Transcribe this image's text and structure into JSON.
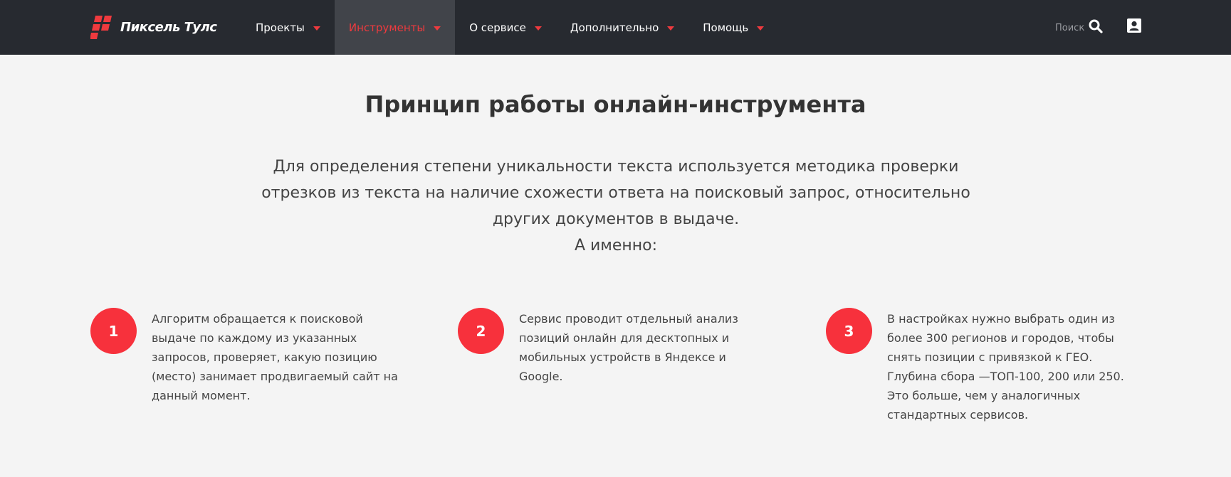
{
  "header": {
    "logo_text": "Пиксель Тулс",
    "nav": [
      {
        "label": "Проекты",
        "active": false
      },
      {
        "label": "Инструменты",
        "active": true
      },
      {
        "label": "О сервисе",
        "active": false
      },
      {
        "label": "Дополнительно",
        "active": false
      },
      {
        "label": "Помощь",
        "active": false
      }
    ],
    "search_label": "Поиск",
    "icons": {
      "logo": "pixel-tools-logo-icon",
      "caret": "caret-down-icon",
      "search": "search-icon",
      "user": "user-account-icon"
    }
  },
  "main": {
    "title": "Принцип работы онлайн-инструмента",
    "intro": "Для определения степени уникальности текста используется методика проверки отрезков из текста на наличие схожести ответа на поисковый запрос, относительно других документов в выдаче.",
    "intro_tail": "А именно:",
    "features": [
      {
        "number": "1",
        "text": "Алгоритм обращается к поисковой выдаче по каждому из указанных запросов, проверяет, какую позицию (место) занимает продвигаемый сайт на данный момент."
      },
      {
        "number": "2",
        "text": "Сервис проводит отдельный анализ позиций онлайн для десктопных и мобильных устройств в Яндексе и Google."
      },
      {
        "number": "3",
        "text": "В настройках нужно выбрать один из более 300 регионов и городов, чтобы снять позиции с привязкой к ГЕО. Глубина сбора —ТОП-100, 200 или 250. Это больше, чем у аналогичных стандартных сервисов."
      }
    ]
  },
  "colors": {
    "header_bg": "#272a30",
    "active_nav_bg": "#41444a",
    "accent_red": "#ef3a3e",
    "badge_red": "#f7313c",
    "page_bg": "#f4f4f4"
  }
}
